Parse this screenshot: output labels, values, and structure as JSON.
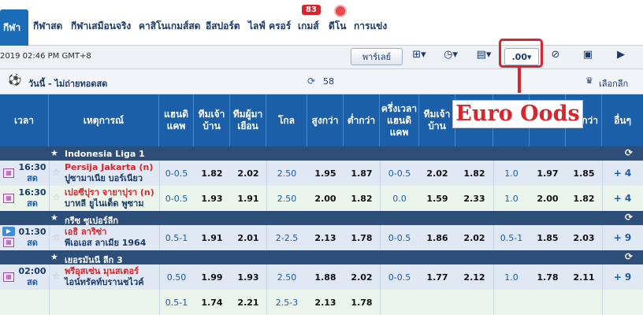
{
  "nav": {
    "tabs": [
      "กีฬา",
      "กีฬาสด",
      "กีฬาเสมือนจริง",
      "คาสิโนเกมส์สด",
      "อีสปอร์ต",
      "ไลฟ์ ครอร์",
      "เกมส์",
      "ดีโน",
      "การแข่ง"
    ],
    "games_badge": "83"
  },
  "toolbar": {
    "clock": "2019 02:46 PM GMT+8",
    "parlay_label": "พาร์เลย์",
    "odds_format": ".00"
  },
  "section": {
    "title": "วันนี้ - ไม่ถ่ายทอดสด",
    "count": "58",
    "league_pick": "เลือกลีก"
  },
  "headers": [
    "เวลา",
    "เหตุการณ์",
    "แฮนดิแคพ",
    "ทีมเจ้าบ้าน",
    "ทีมผู้มาเยือน",
    "โกล",
    "สูงกว่า",
    "ต่ำกว่า",
    "ครึ่งเวลาแฮนดิแคพ",
    "ทีมเจ้าบ้าน",
    "",
    "",
    "",
    "ต่ำกว่า",
    "อื่นๆ"
  ],
  "annotation": "Euro Oods",
  "leagues": [
    {
      "name": "Indonesia Liga 1",
      "rows": [
        {
          "time": "16:30",
          "status": "สด",
          "home": "Persija Jakarta (n)",
          "away": "ปูซามาเนีย บอร์เนียว",
          "hdp": "0-0.5",
          "h": "1.82",
          "a": "2.02",
          "goal": "2.50",
          "over": "1.95",
          "under": "1.87",
          "fh_hdp": "0-0.5",
          "fh_h": "2.02",
          "fh_a": "1.82",
          "fh_goal": "1.0",
          "fh_over": "1.97",
          "fh_under": "1.85",
          "more": "+ 4"
        },
        {
          "time": "16:30",
          "status": "สด",
          "home": "เปอซีปุรา จายาปุรา (n)",
          "away": "บาหลี ยูไนเต็ด พูซาม",
          "hdp": "0-0.5",
          "h": "1.93",
          "a": "1.91",
          "goal": "2.50",
          "over": "2.00",
          "under": "1.82",
          "fh_hdp": "0.0",
          "fh_h": "1.59",
          "fh_a": "2.33",
          "fh_goal": "1.0",
          "fh_over": "2.00",
          "fh_under": "1.82",
          "more": "+ 4"
        }
      ]
    },
    {
      "name": "กรีซ ซูเปอร์ลีก",
      "rows": [
        {
          "time": "01:30",
          "status": "สด",
          "home": "เอธิ ลาริซ่า",
          "away": "พีเอเอส ลาเมีย 1964",
          "hdp": "0.5-1",
          "h": "1.91",
          "a": "2.01",
          "goal": "2-2.5",
          "over": "2.13",
          "under": "1.78",
          "fh_hdp": "0-0.5",
          "fh_h": "1.86",
          "fh_a": "2.02",
          "fh_goal": "0.5-1",
          "fh_over": "1.85",
          "fh_under": "2.03",
          "more": "+ 9"
        }
      ]
    },
    {
      "name": "เยอรมันนี ลีก 3",
      "rows": [
        {
          "time": "02:00",
          "status": "สด",
          "home": "พรีอุสเซ่น มุนสเตอร์",
          "away": "ไอน์ทรัคท์บรานชไวค์",
          "hdp": "0.50",
          "h": "1.99",
          "a": "1.93",
          "goal": "2.50",
          "over": "1.88",
          "under": "2.02",
          "fh_hdp": "0-0.5",
          "fh_h": "1.77",
          "fh_a": "2.12",
          "fh_goal": "1.0",
          "fh_over": "1.78",
          "fh_under": "2.11",
          "more": "+ 9"
        },
        {
          "time": "",
          "status": "",
          "home": "",
          "away": "",
          "hdp": "0.5-1",
          "h": "1.74",
          "a": "2.21",
          "goal": "2.5-3",
          "over": "2.13",
          "under": "1.78",
          "fh_hdp": "",
          "fh_h": "",
          "fh_a": "",
          "fh_goal": "",
          "fh_over": "",
          "fh_under": "",
          "more": ""
        }
      ]
    }
  ],
  "colors": {
    "header": "#1b5fa8",
    "league_bar": "#2d4e79",
    "accent_red": "#d9262d",
    "row_a": "#dfe8f3",
    "row_b": "#eaf4ea"
  }
}
